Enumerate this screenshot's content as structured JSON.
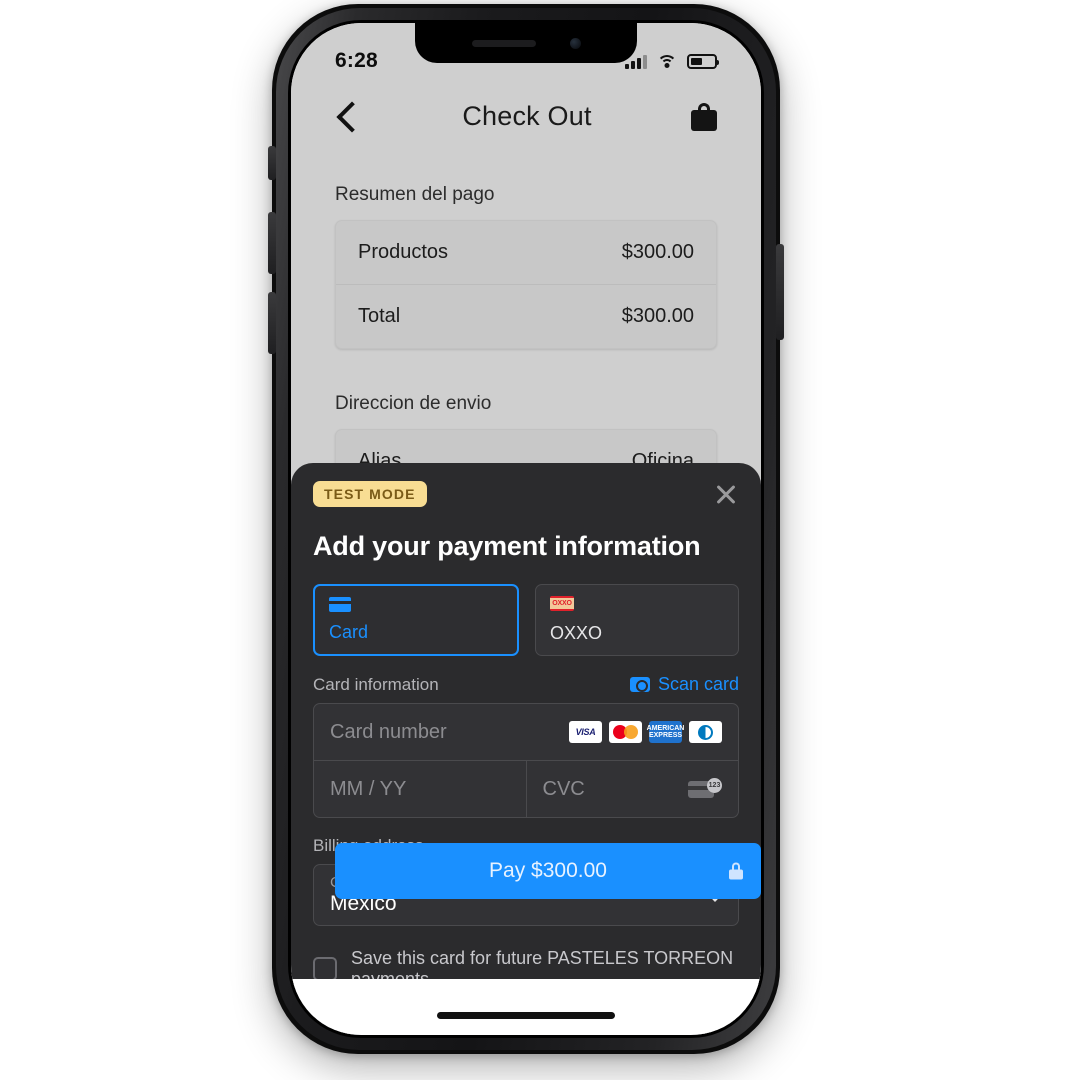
{
  "status_bar": {
    "time": "6:28",
    "signal_icon": "cellular-signal-icon",
    "wifi_icon": "wifi-icon",
    "battery_icon": "battery-icon"
  },
  "app": {
    "nav": {
      "back_icon": "back-chevron-icon",
      "title": "Check Out",
      "bag_icon": "shopping-bag-icon"
    },
    "payment_summary": {
      "section_label": "Resumen del pago",
      "rows": [
        {
          "label": "Productos",
          "value": "$300.00"
        },
        {
          "label": "Total",
          "value": "$300.00"
        }
      ]
    },
    "shipping": {
      "section_label": "Direccion de envio",
      "rows": [
        {
          "label": "Alias",
          "value": "Oficina"
        }
      ]
    }
  },
  "sheet": {
    "test_badge": "TEST MODE",
    "close_icon": "close-icon",
    "title": "Add your payment information",
    "tabs": [
      {
        "label": "Card",
        "icon": "credit-card-icon",
        "selected": true
      },
      {
        "label": "OXXO",
        "icon": "oxxo-logo-icon",
        "selected": false
      }
    ],
    "card_information": {
      "label": "Card information",
      "scan_label": "Scan card",
      "scan_icon": "camera-icon",
      "card_number_placeholder": "Card number",
      "expiry_placeholder": "MM / YY",
      "cvc_placeholder": "CVC",
      "cvc_hint_icon": "cvc-card-icon",
      "cvc_hint_digits": "123",
      "brands": [
        {
          "name": "visa-icon",
          "label": "VISA"
        },
        {
          "name": "mastercard-icon",
          "label": ""
        },
        {
          "name": "amex-icon",
          "label": "AMERICAN EXPRESS"
        },
        {
          "name": "diners-club-icon",
          "label": ""
        }
      ]
    },
    "billing_address": {
      "label": "Billing address",
      "country_caption": "Country or region",
      "country_value": "Mexico",
      "chevron_icon": "chevron-down-icon"
    },
    "save_card": {
      "label": "Save this card for future PASTELES TORREON payments",
      "checked": false
    },
    "pay_button": {
      "label": "Pay $300.00",
      "lock_icon": "lock-icon"
    }
  },
  "colors": {
    "accent_blue": "#1a90ff",
    "sheet_bg": "#2b2b2d",
    "app_bg": "#cfcfcf",
    "badge_bg": "#f8dd93",
    "badge_text": "#7a5b17"
  }
}
